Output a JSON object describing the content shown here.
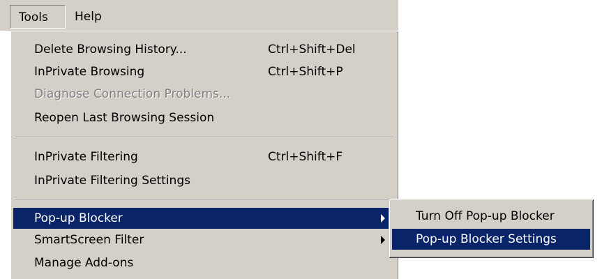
{
  "menubar": {
    "tools_label": "Tools",
    "help_label": "Help"
  },
  "tools_menu": {
    "items": [
      {
        "label": "Delete Browsing History...",
        "shortcut": "Ctrl+Shift+Del"
      },
      {
        "label": "InPrivate Browsing",
        "shortcut": "Ctrl+Shift+P"
      },
      {
        "label": "Diagnose Connection Problems...",
        "shortcut": "",
        "disabled": true
      },
      {
        "label": "Reopen Last Browsing Session",
        "shortcut": ""
      },
      {
        "label": "InPrivate Filtering",
        "shortcut": "Ctrl+Shift+F"
      },
      {
        "label": "InPrivate Filtering Settings",
        "shortcut": ""
      },
      {
        "label": "Pop-up Blocker",
        "shortcut": "",
        "submenu": true,
        "highlighted": true
      },
      {
        "label": "SmartScreen Filter",
        "shortcut": "",
        "submenu": true
      },
      {
        "label": "Manage Add-ons",
        "shortcut": ""
      }
    ]
  },
  "popup_blocker_submenu": {
    "items": [
      {
        "label": "Turn Off Pop-up Blocker"
      },
      {
        "label": "Pop-up Blocker Settings",
        "highlighted": true
      }
    ]
  },
  "colors": {
    "menu_background": "#d4d0c8",
    "highlight": "#0a246a",
    "highlight_text": "#ffffff",
    "disabled_text": "#808080"
  }
}
